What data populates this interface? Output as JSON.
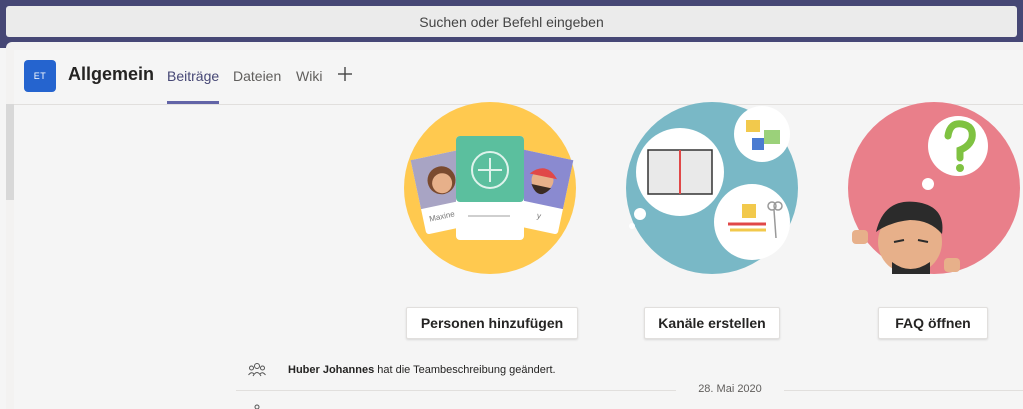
{
  "search": {
    "placeholder": "Suchen oder Befehl eingeben"
  },
  "team": {
    "avatar_initials": "ET",
    "channel_name": "Allgemein"
  },
  "tabs": [
    {
      "label": "Beiträge",
      "active": true
    },
    {
      "label": "Dateien",
      "active": false
    },
    {
      "label": "Wiki",
      "active": false
    }
  ],
  "illustrations": {
    "card_label_left": "Maxine",
    "card_label_right": "y"
  },
  "actions": {
    "add_people": "Personen hinzufügen",
    "create_channels": "Kanäle erstellen",
    "open_faq": "FAQ öffnen"
  },
  "activity": {
    "actor": "Huber Johannes",
    "text": " hat die Teambeschreibung geändert."
  },
  "date_separator": "28. Mai 2020",
  "colors": {
    "header_bar": "#464775",
    "accent": "#6264a7",
    "avatar": "#2564cf",
    "circle_people": "#ffc94f",
    "circle_channels": "#79b8c6",
    "circle_faq": "#e97f8a"
  }
}
